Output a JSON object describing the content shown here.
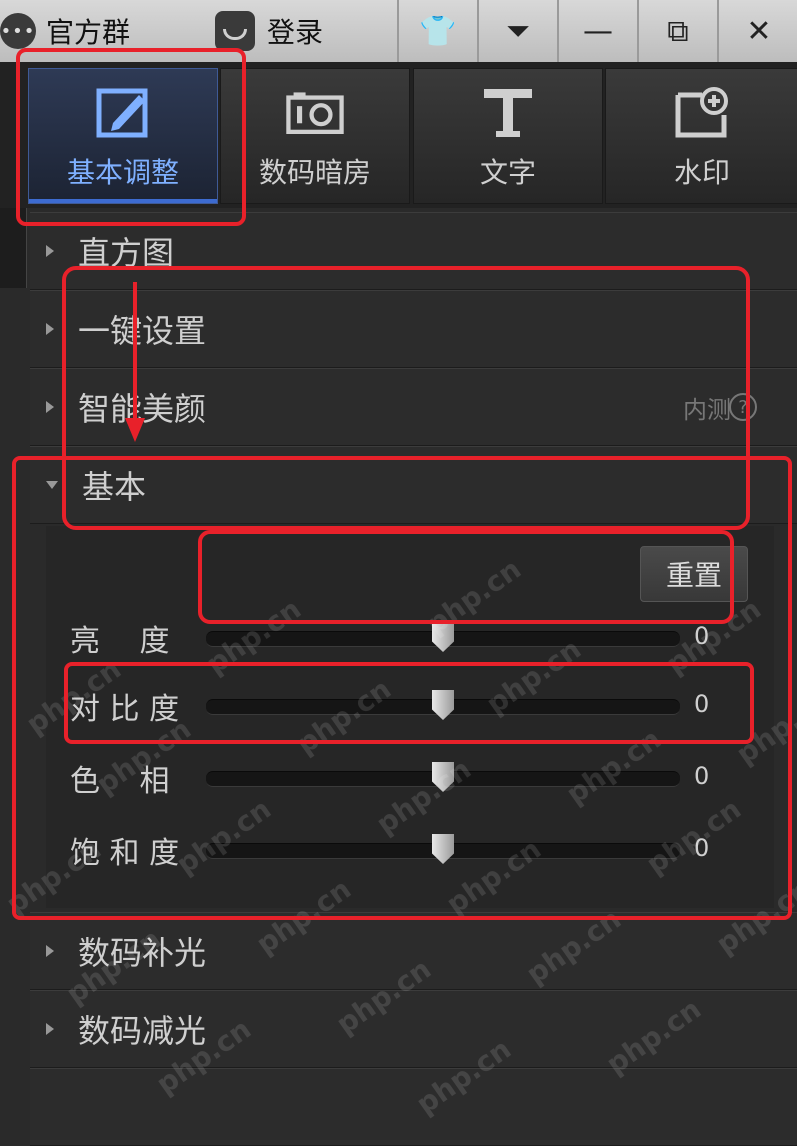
{
  "titlebar": {
    "group_label": "官方群",
    "login_label": "登录",
    "buttons": {
      "skin_glyph": "👕",
      "menu_glyph": "⏷",
      "minimize_glyph": "—",
      "restore_glyph": "⧉",
      "close_glyph": "✕"
    }
  },
  "tabs": [
    {
      "label": "基本调整",
      "icon": "edit-icon",
      "active": true
    },
    {
      "label": "数码暗房",
      "icon": "camera-icon"
    },
    {
      "label": "文字",
      "icon": "text-icon"
    },
    {
      "label": "水印",
      "icon": "watermark-add-icon"
    }
  ],
  "sections": [
    {
      "label": "直方图",
      "expanded": false
    },
    {
      "label": "一键设置",
      "expanded": false
    },
    {
      "label": "智能美颜",
      "expanded": false,
      "badge": "内测",
      "help": "?"
    },
    {
      "label": "基本",
      "expanded": true
    },
    {
      "label": "数码补光",
      "expanded": false
    },
    {
      "label": "数码减光",
      "expanded": false
    }
  ],
  "basic": {
    "reset_label": "重置",
    "sliders": [
      {
        "label": "亮　 度",
        "value": "0",
        "level": 0.5
      },
      {
        "label": "对 比 度",
        "value": "0",
        "level": 0.5
      },
      {
        "label": "色　 相",
        "value": "0",
        "level": 0.5
      },
      {
        "label": "饱 和 度",
        "value": "0",
        "level": 0.5
      }
    ]
  },
  "colors": {
    "annotation_red": "#e8212a",
    "active_tab_text": "#7fb0ff",
    "panel_bg": "#2c2c2c"
  },
  "watermark_text": "php.cn"
}
